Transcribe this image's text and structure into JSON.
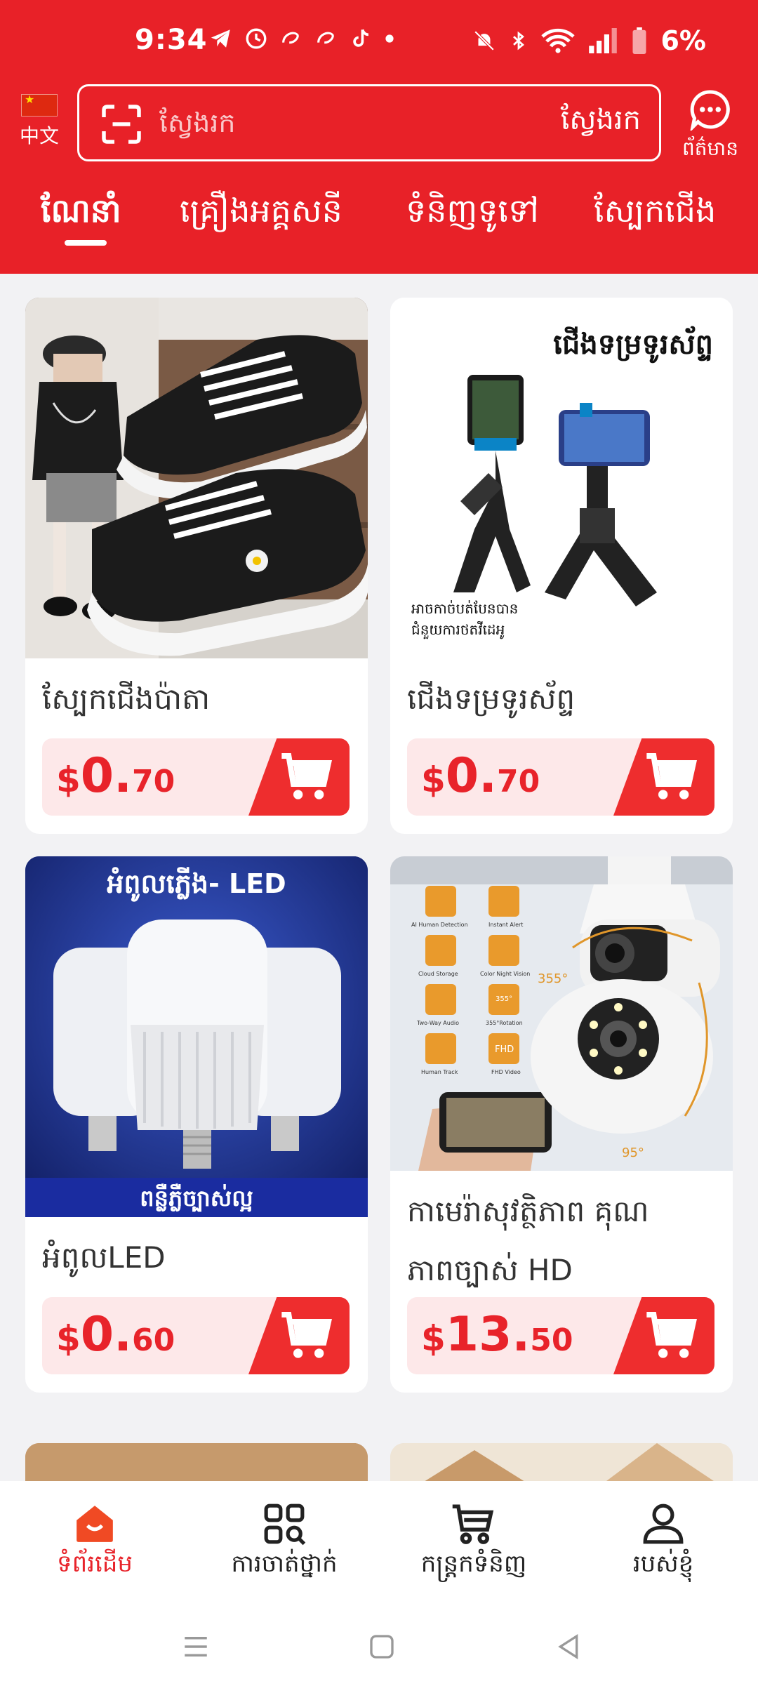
{
  "status_bar": {
    "time": "9:34",
    "battery": "6%"
  },
  "header": {
    "language_label": "中文",
    "search": {
      "placeholder": "ស្វែងរក",
      "button_label": "ស្វែងរក"
    },
    "messages_label": "ព័ត៌មាន",
    "tabs": [
      {
        "label": "ណែនាំ",
        "active": true
      },
      {
        "label": "គ្រឿងអគ្គសនី",
        "active": false
      },
      {
        "label": "ទំនិញទូទៅ",
        "active": false
      },
      {
        "label": "ស្បែកជើង",
        "active": false
      }
    ],
    "accent_color": "#e82128"
  },
  "products": [
    {
      "title": "ស្បែកជើងប៉ាតា",
      "currency": "$",
      "price_int": "0.",
      "price_dec": "70",
      "image_text": ""
    },
    {
      "title": "ជើងទម្រទូរស័ព្ទ",
      "currency": "$",
      "price_int": "0.",
      "price_dec": "70",
      "image_text": "ជើងទម្រទូរស័ព្ទ",
      "image_subtext_1": "អាចកាច់បត់បែនបាន",
      "image_subtext_2": "ជំនួយការថតវីដេអូ"
    },
    {
      "title": "អំពូលLED",
      "currency": "$",
      "price_int": "0.",
      "price_dec": "60",
      "image_text": "អំពូលភ្លើង- LED",
      "image_subtext_1": "ពន្លឺភ្លឺច្បាស់ល្អ"
    },
    {
      "title": "កាមេរ៉ាសុវត្ថិភាព គុណ\nភាពច្បាស់ HD",
      "currency": "$",
      "price_int": "13.",
      "price_dec": "50",
      "image_features": [
        "AI Human Detection",
        "Instant Alert",
        "Cloud Storage",
        "Color Night Vision",
        "Two-Way Audio",
        "355°Rotation",
        "Human Track",
        "FHD Video"
      ],
      "image_rot_1": "355°",
      "image_rot_2": "95°",
      "image_fhd": "FHD",
      "image_deg": "355°"
    }
  ],
  "bottom_nav": [
    {
      "label": "ទំព័រដើម",
      "icon": "home-icon",
      "active": true
    },
    {
      "label": "ការចាត់ថ្នាក់",
      "icon": "category-icon",
      "active": false
    },
    {
      "label": "កន្ត្រកទំនិញ",
      "icon": "cart-icon",
      "active": false
    },
    {
      "label": "របស់ខ្ញុំ",
      "icon": "profile-icon",
      "active": false
    }
  ]
}
